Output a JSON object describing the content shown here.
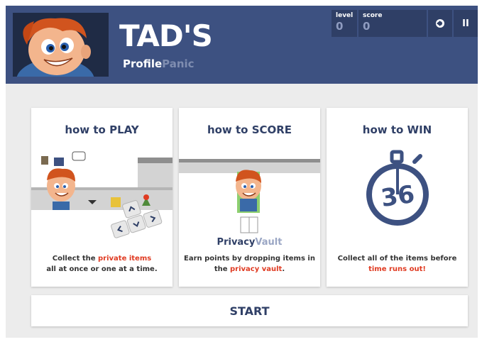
{
  "game": {
    "title": "TAD'S",
    "subtitle_part1": "Profile",
    "subtitle_part2": "Panic"
  },
  "hud": {
    "level_label": "level",
    "level_value": "0",
    "score_label": "score",
    "score_value": "0",
    "sound_icon": "speaker-icon",
    "pause_icon": "pause-icon",
    "pause_glyph": "II"
  },
  "cards": {
    "play": {
      "title": "how to PLAY",
      "desc_pre": "Collect the ",
      "desc_hl": "private items",
      "desc_post": "all at once or one at a time."
    },
    "score": {
      "title": "how to SCORE",
      "vault_part1": "Privacy",
      "vault_part2": "Vault",
      "desc_pre": "Earn points by dropping items in the ",
      "desc_hl": "privacy vault",
      "desc_post": "."
    },
    "win": {
      "title": "how to WIN",
      "timer_value": "36",
      "desc_pre": "Collect all of the items before ",
      "desc_hl": "time runs out!"
    }
  },
  "start_label": "START",
  "colors": {
    "header": "#3d5181",
    "accent_text": "#2f3f66",
    "highlight": "#e03b22",
    "background": "#ececec"
  }
}
